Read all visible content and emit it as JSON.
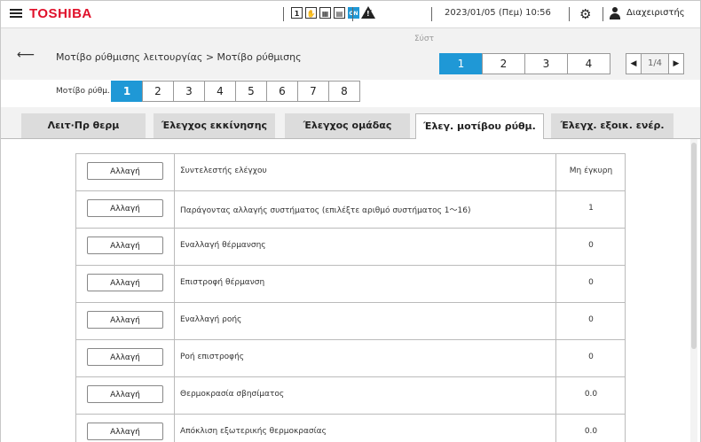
{
  "header": {
    "brand": "TOSHIBA",
    "datetime": "2023/01/05 (Πεμ) 10:56",
    "user": "Διαχειριστής",
    "status_icons": [
      "1",
      "hand-icon",
      "calendar-icon",
      "schedule-icon",
      "ON"
    ]
  },
  "breadcrumb": "Μοτίβο ρύθμισης λειτουργίας  >  Μοτίβο ρύθμισης",
  "system": {
    "label": "Σύστ",
    "tabs": [
      "1",
      "2",
      "3",
      "4"
    ],
    "active": "1",
    "page": "1/4"
  },
  "pattern": {
    "label": "Μοτίβο ρύθμ.",
    "tabs": [
      "1",
      "2",
      "3",
      "4",
      "5",
      "6",
      "7",
      "8"
    ],
    "active": "1"
  },
  "categories": [
    "Λειτ·Πρ θερμ",
    "Έλεγχος εκκίνησης",
    "Έλεγχος ομάδας",
    "Έλεγ. μοτίβου ρύθμ.",
    "Έλεγχ. εξοικ. ενέρ."
  ],
  "active_category": "Έλεγ. μοτίβου ρύθμ.",
  "settings": [
    {
      "button": "Αλλαγή",
      "name": "Συντελεστής ελέγχου",
      "value": "Μη έγκυρη"
    },
    {
      "button": "Αλλαγή",
      "name": "Παράγοντας αλλαγής συστήματος (επιλέξτε αριθμό συστήματος 1～16)",
      "value": "1"
    },
    {
      "button": "Αλλαγή",
      "name": "Εναλλαγή θέρμανσης",
      "value": "0"
    },
    {
      "button": "Αλλαγή",
      "name": "Επιστροφή θέρμανση",
      "value": "0"
    },
    {
      "button": "Αλλαγή",
      "name": "Εναλλαγή ροής",
      "value": "0"
    },
    {
      "button": "Αλλαγή",
      "name": "Ροή επιστροφής",
      "value": "0"
    },
    {
      "button": "Αλλαγή",
      "name": "Θερμοκρασία σβησίματος",
      "value": "0.0"
    },
    {
      "button": "Αλλαγή",
      "name": "Απόκλιση εξωτερικής θερμοκρασίας",
      "value": "0.0"
    }
  ],
  "colors": {
    "brand": "#e0102a",
    "accent": "#1f98d6"
  }
}
